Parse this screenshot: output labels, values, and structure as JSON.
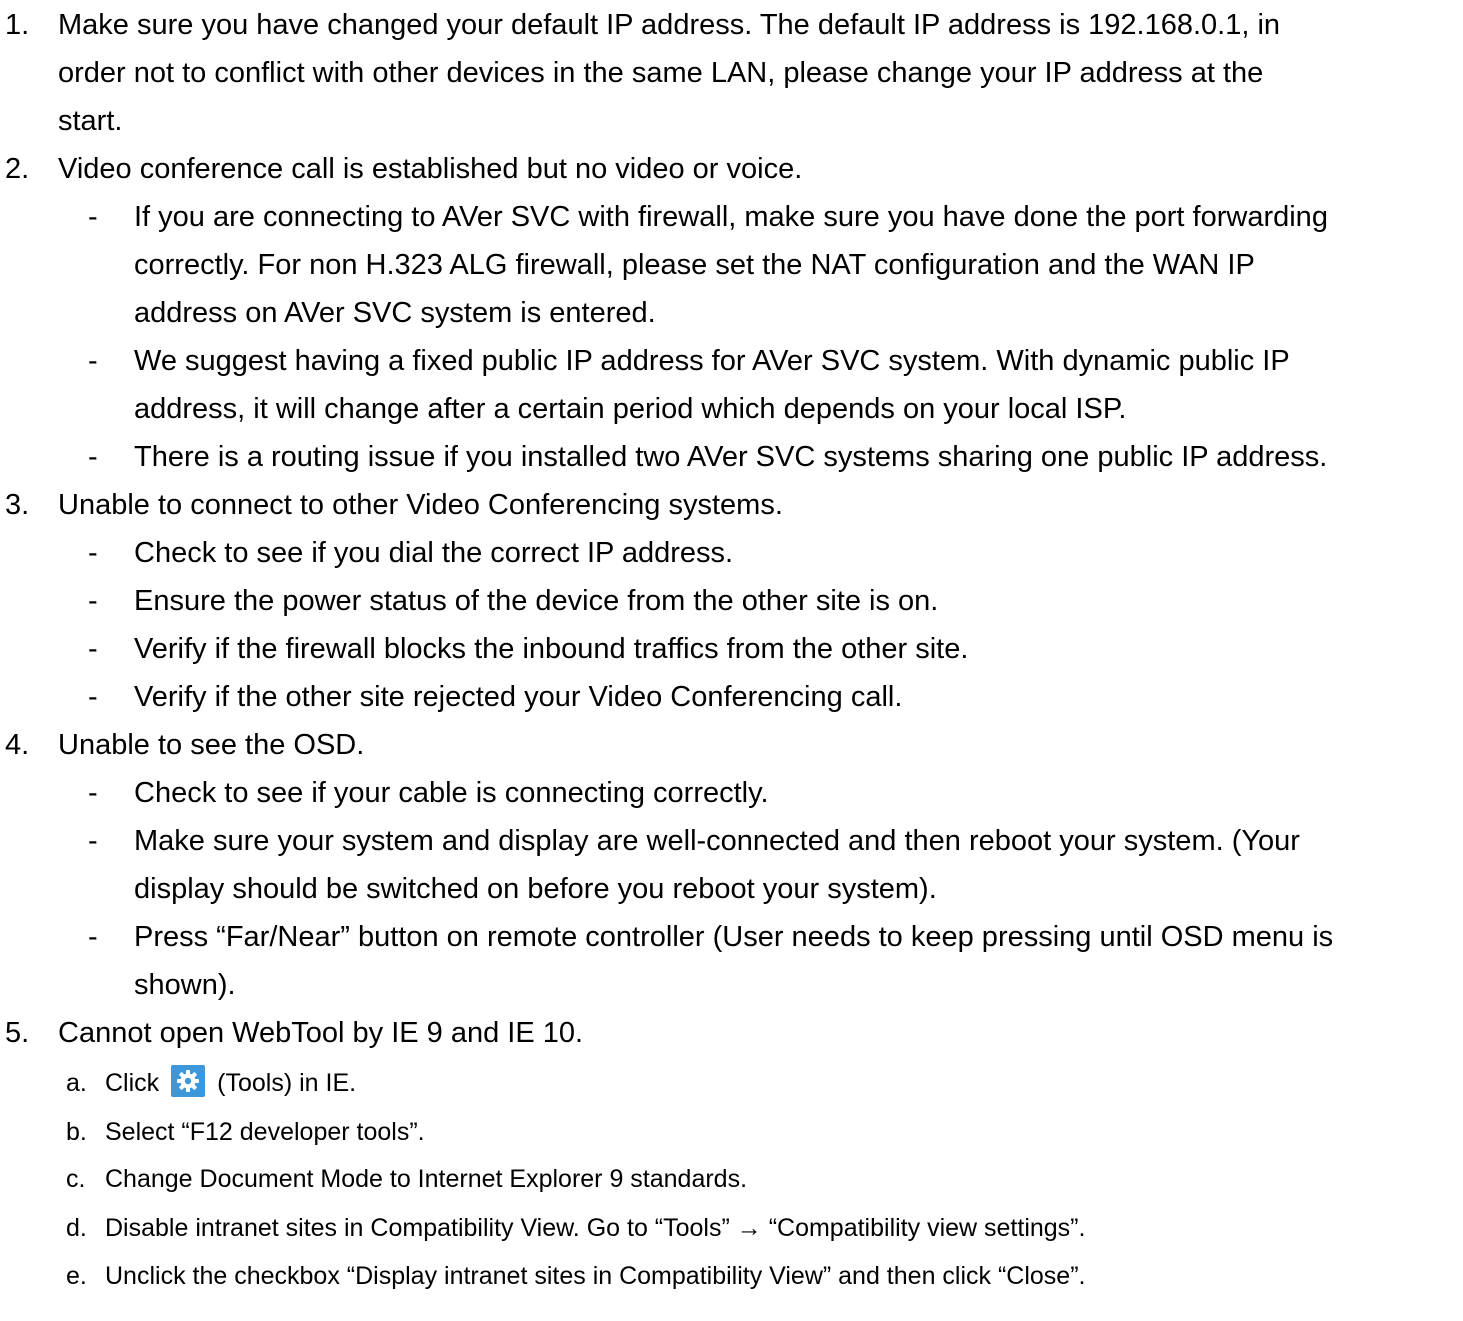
{
  "items": [
    {
      "num": "1.",
      "lines": [
        "Make sure you have changed your default IP address. The default IP address is 192.168.0.1, in",
        "order not to conflict with other devices in the same LAN, please change your IP address at the",
        "start."
      ]
    },
    {
      "num": "2.",
      "lines": [
        "Video conference call is established but no video or voice."
      ],
      "bullets": [
        {
          "lines": [
            "If you are connecting to AVer SVC with firewall, make sure you have done the port forwarding",
            "correctly. For non H.323 ALG firewall, please set the NAT configuration and the WAN IP",
            "address on AVer SVC system is entered."
          ]
        },
        {
          "lines": [
            "We suggest having a fixed public IP address for AVer SVC system. With dynamic public IP",
            "address, it will change after a certain period which depends on your local ISP."
          ]
        },
        {
          "lines": [
            "There is a routing issue if you installed two AVer SVC systems sharing one public IP address."
          ]
        }
      ]
    },
    {
      "num": "3.",
      "lines": [
        "Unable to connect to other Video Conferencing systems."
      ],
      "bullets": [
        {
          "lines": [
            "Check to see if you dial the correct IP address."
          ]
        },
        {
          "lines": [
            "Ensure the power status of the device from the other site is on."
          ]
        },
        {
          "lines": [
            "Verify if the firewall blocks the inbound traffics from the other site."
          ]
        },
        {
          "lines": [
            "Verify if the other site rejected your Video Conferencing call."
          ]
        }
      ]
    },
    {
      "num": "4.",
      "lines": [
        "Unable to see the OSD."
      ],
      "bullets": [
        {
          "lines": [
            "Check to see if your cable is connecting correctly."
          ]
        },
        {
          "lines": [
            "Make sure your system and display are well-connected and then reboot your system. (Your",
            "display should be switched on before you reboot your system)."
          ]
        },
        {
          "lines": [
            "Press “Far/Near” button on remote controller (User needs to keep pressing until OSD menu is",
            "shown)."
          ]
        }
      ]
    },
    {
      "num": "5.",
      "lines": [
        "Cannot open WebTool by IE 9 and IE 10."
      ],
      "steps": [
        {
          "label": "a.",
          "text_before": "Click",
          "icon": "gear-icon",
          "text_after": "(Tools) in IE."
        },
        {
          "label": "b.",
          "text": "Select “F12 developer tools”."
        },
        {
          "label": "c.",
          "text": "Change Document Mode to Internet Explorer 9 standards."
        },
        {
          "label": "d.",
          "text": "Disable intranet sites in Compatibility View. Go to “Tools” → “Compatibility view settings”."
        },
        {
          "label": "e.",
          "text": "Unclick the checkbox “Display intranet sites in Compatibility View” and then click “Close”."
        }
      ]
    }
  ],
  "dash": "-",
  "icon_color": "#3d97d8"
}
